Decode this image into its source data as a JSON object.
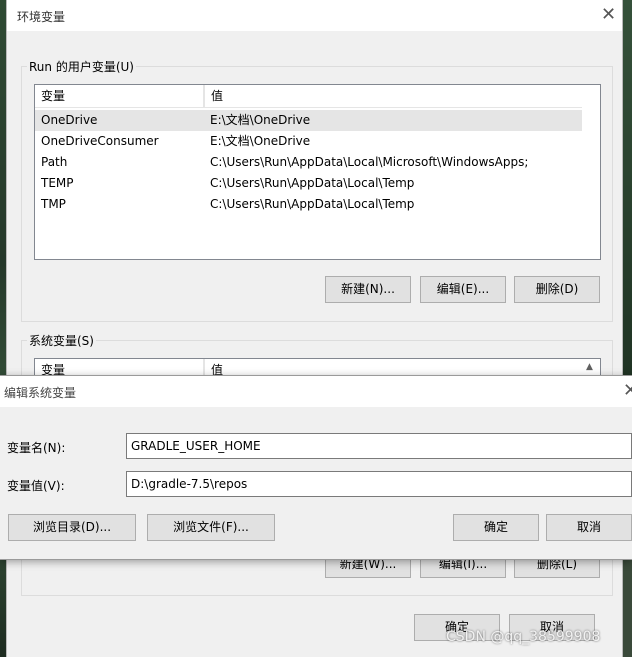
{
  "env_dialog": {
    "title": "环境变量",
    "user_group_label": "Run 的用户变量(U)",
    "user_table": {
      "headers": [
        "变量",
        "值"
      ],
      "rows": [
        {
          "name": "OneDrive",
          "value": "E:\\文档\\OneDrive"
        },
        {
          "name": "OneDriveConsumer",
          "value": "E:\\文档\\OneDrive"
        },
        {
          "name": "Path",
          "value": "C:\\Users\\Run\\AppData\\Local\\Microsoft\\WindowsApps;"
        },
        {
          "name": "TEMP",
          "value": "C:\\Users\\Run\\AppData\\Local\\Temp"
        },
        {
          "name": "TMP",
          "value": "C:\\Users\\Run\\AppData\\Local\\Temp"
        }
      ]
    },
    "user_buttons": {
      "new": "新建(N)...",
      "edit": "编辑(E)...",
      "delete": "删除(D)"
    },
    "system_group_label": "系统变量(S)",
    "system_table": {
      "headers": [
        "变量",
        "值"
      ]
    },
    "system_buttons": {
      "new": "新建(W)...",
      "edit": "编辑(I)...",
      "delete": "删除(L)"
    },
    "ok": "确定",
    "cancel": "取消"
  },
  "edit_dialog": {
    "title": "编辑系统变量",
    "name_label": "变量名(N):",
    "name_value": "GRADLE_USER_HOME",
    "value_label": "变量值(V):",
    "value_value": "D:\\gradle-7.5\\repos",
    "browse_dir": "浏览目录(D)...",
    "browse_file": "浏览文件(F)...",
    "ok": "确定",
    "cancel": "取消"
  },
  "watermark": "CSDN @qq_38599908"
}
